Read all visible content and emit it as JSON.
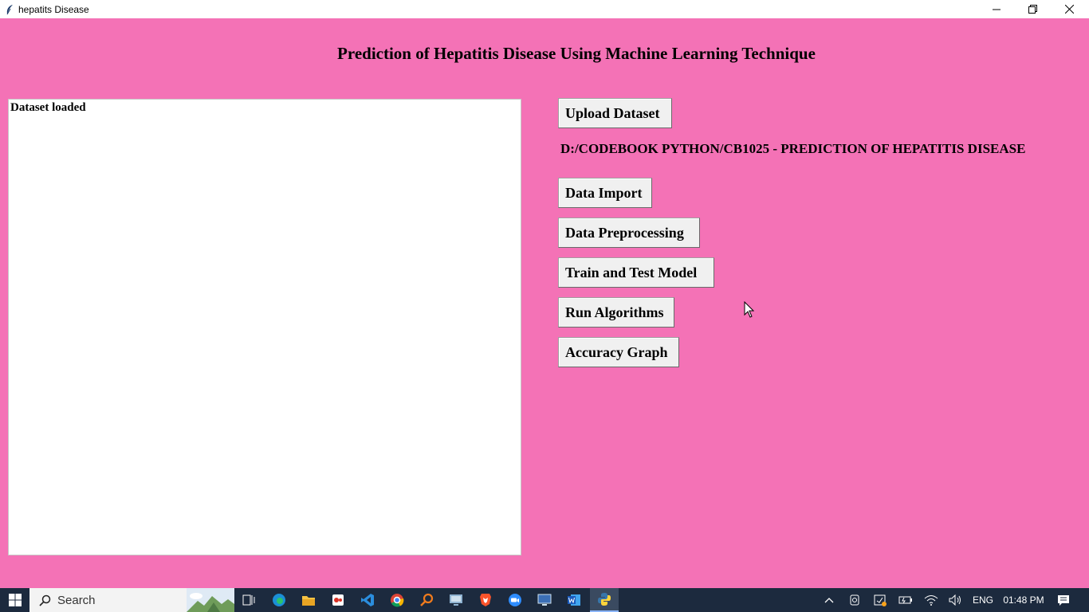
{
  "window": {
    "title": "hepatits Disease"
  },
  "page": {
    "title": "Prediction of Hepatitis Disease Using Machine Learning Technique"
  },
  "output": {
    "text": "Dataset loaded"
  },
  "buttons": {
    "upload": "Upload Dataset",
    "import": "Data Import",
    "preprocess": "Data Preprocessing",
    "train": "Train and Test Model",
    "algorithms": "Run Algorithms",
    "graph": "Accuracy Graph"
  },
  "dataset_path": "D:/CODEBOOK PYTHON/CB1025 - PREDICTION OF HEPATITIS DISEASE",
  "taskbar": {
    "search_placeholder": "Search",
    "apps": [
      "task-view-icon",
      "edge-icon",
      "file-explorer-icon",
      "app-red-icon",
      "vscode-icon",
      "chrome-icon",
      "search-app-icon",
      "remote-desktop-icon",
      "brave-icon",
      "zoom-icon",
      "screen-app-icon",
      "word-icon",
      "python-icon"
    ],
    "language": "ENG",
    "time": "01:48 PM"
  },
  "colors": {
    "background": "#f472b6",
    "taskbar": "#1c2a3e"
  }
}
